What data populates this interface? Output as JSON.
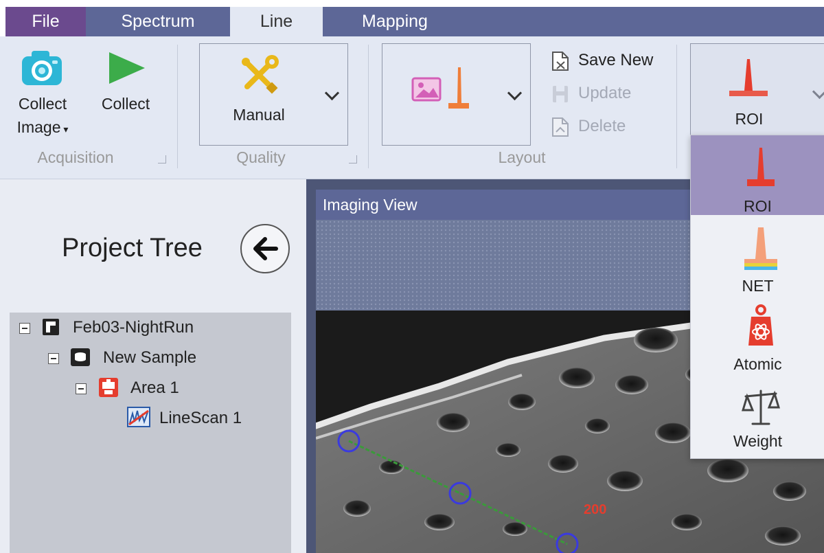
{
  "tabs": {
    "file": "File",
    "spectrum": "Spectrum",
    "line": "Line",
    "mapping": "Mapping"
  },
  "ribbon": {
    "acquisition": {
      "collect_image_line1": "Collect",
      "collect_image_line2": "Image",
      "collect": "Collect",
      "group_label": "Acquisition"
    },
    "quality": {
      "selected": "Manual",
      "group_label": "Quality"
    },
    "layout": {
      "save_new": "Save New",
      "update": "Update",
      "delete": "Delete",
      "group_label": "Layout"
    },
    "quant": {
      "selected": "ROI"
    }
  },
  "project_tree": {
    "title": "Project Tree",
    "nodes": [
      {
        "label": "Feb03-NightRun"
      },
      {
        "label": "New Sample"
      },
      {
        "label": "Area 1"
      },
      {
        "label": "LineScan 1"
      }
    ]
  },
  "imaging_view": {
    "title": "Imaging View",
    "scale_marker": "200"
  },
  "quant_menu": {
    "items": [
      {
        "label": "ROI"
      },
      {
        "label": "NET"
      },
      {
        "label": "Atomic"
      },
      {
        "label": "Weight"
      }
    ]
  },
  "colors": {
    "tab_bar": "#5d6797",
    "file_tab": "#6b4a8e",
    "ribbon_bg": "#e3e8f3",
    "menu_selected": "#9c92bf",
    "line_scan": "#3a9a3a",
    "scan_point": "#3a3adf"
  }
}
